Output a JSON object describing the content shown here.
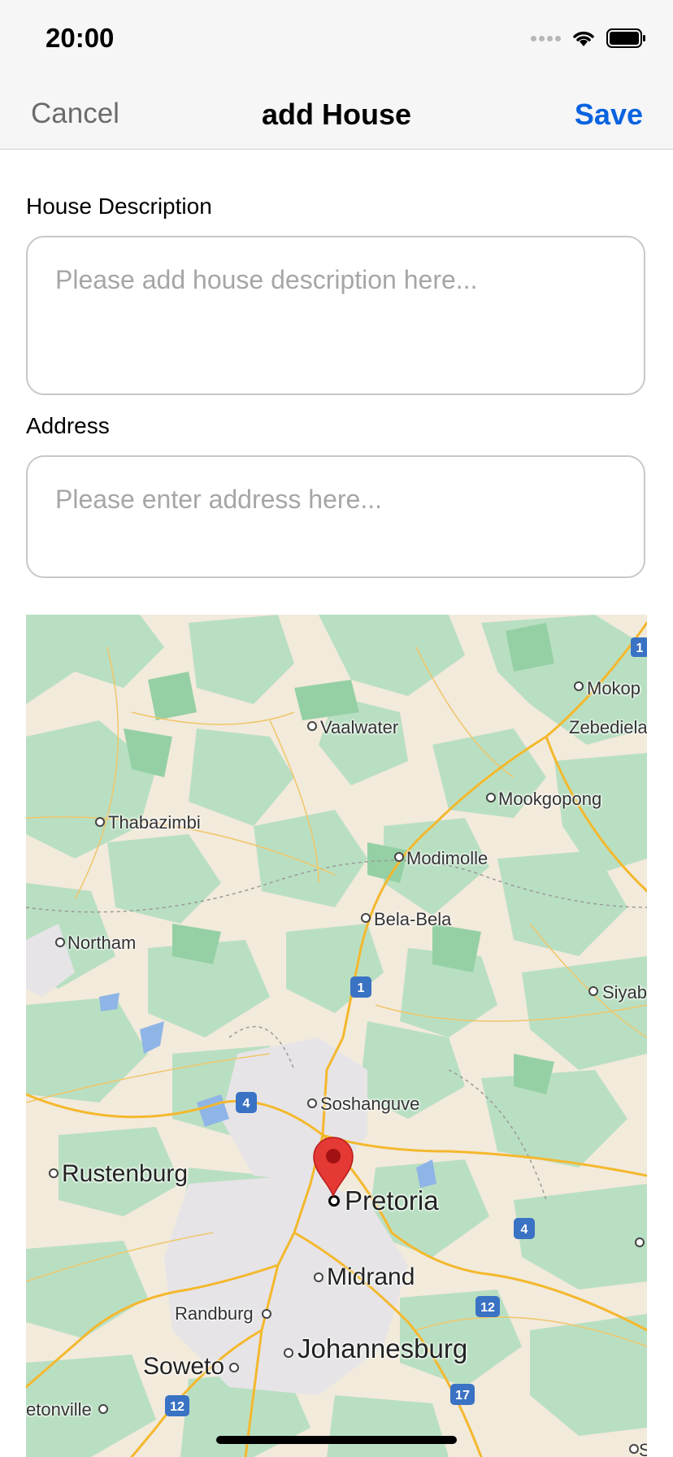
{
  "status_bar": {
    "time": "20:00",
    "icons": [
      "signal-icon",
      "wifi-icon",
      "battery-icon"
    ]
  },
  "nav": {
    "cancel_label": "Cancel",
    "title": "add House",
    "save_label": "Save",
    "save_color": "#0a63e0"
  },
  "form": {
    "description_label": "House Description",
    "description_placeholder": "Please add house description here...",
    "address_label": "Address",
    "address_placeholder": "Please enter address here..."
  },
  "map": {
    "places": {
      "mokop": "Mokop",
      "zebediela": "Zebediela",
      "vaalwater": "Vaalwater",
      "mookgopong": "Mookgopong",
      "thabazimbi": "Thabazimbi",
      "modimolle": "Modimolle",
      "bela_bela": "Bela-Bela",
      "northam": "Northam",
      "siyab": "Siyab",
      "soshanguve": "Soshanguve",
      "rustenburg": "Rustenburg",
      "pretoria": "Pretoria",
      "midrand": "Midrand",
      "randburg": "Randburg",
      "soweto": "Soweto",
      "johannesburg": "Johannesburg",
      "etonville": "etonville",
      "s_edge": "S"
    },
    "road_shields": [
      "1",
      "1",
      "4",
      "4",
      "12",
      "12",
      "17"
    ],
    "pin_color": "#e53935"
  }
}
